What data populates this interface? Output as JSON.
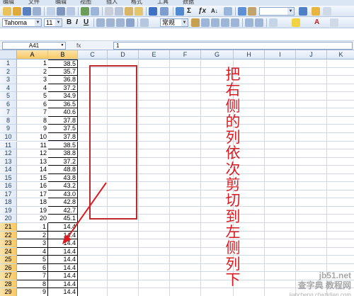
{
  "menu": {
    "items": [
      "编辑",
      "文件",
      "编辑",
      "视图",
      "插入",
      "格式",
      "工具",
      "数据"
    ]
  },
  "toolbar": {
    "font_name": "Tahoma",
    "font_size": "11",
    "number_format": "常规",
    "bold_label": "B",
    "italic_label": "I",
    "underline_label": "U",
    "sum_label": "Σ",
    "fx_label": "ƒx",
    "sort_label": "A↓",
    "font_color_label": "A"
  },
  "formula_bar": {
    "name_box": "A41",
    "fx_label": "fx",
    "value": "1"
  },
  "columns": [
    "A",
    "B",
    "C",
    "D",
    "E",
    "F",
    "G",
    "H",
    "I",
    "J",
    "K"
  ],
  "rows": [
    {
      "num": "1",
      "a": "1",
      "b": "38.5"
    },
    {
      "num": "2",
      "a": "2",
      "b": "35.7"
    },
    {
      "num": "3",
      "a": "3",
      "b": "36.8"
    },
    {
      "num": "4",
      "a": "4",
      "b": "37.2"
    },
    {
      "num": "5",
      "a": "5",
      "b": "34.9"
    },
    {
      "num": "6",
      "a": "6",
      "b": "36.5"
    },
    {
      "num": "7",
      "a": "7",
      "b": "40.6"
    },
    {
      "num": "8",
      "a": "8",
      "b": "37.8"
    },
    {
      "num": "9",
      "a": "9",
      "b": "37.5"
    },
    {
      "num": "10",
      "a": "10",
      "b": "37.8"
    },
    {
      "num": "11",
      "a": "11",
      "b": "38.5"
    },
    {
      "num": "12",
      "a": "12",
      "b": "38.8"
    },
    {
      "num": "13",
      "a": "13",
      "b": "37.2"
    },
    {
      "num": "14",
      "a": "14",
      "b": "48.8"
    },
    {
      "num": "15",
      "a": "15",
      "b": "43.8"
    },
    {
      "num": "16",
      "a": "16",
      "b": "43.2"
    },
    {
      "num": "17",
      "a": "17",
      "b": "43.0"
    },
    {
      "num": "18",
      "a": "18",
      "b": "42.8"
    },
    {
      "num": "19",
      "a": "19",
      "b": "42.7"
    },
    {
      "num": "20",
      "a": "20",
      "b": "45.1"
    },
    {
      "num": "21",
      "a": "1",
      "b": "14.4"
    },
    {
      "num": "22",
      "a": "2",
      "b": "14.4"
    },
    {
      "num": "23",
      "a": "3",
      "b": "14.4"
    },
    {
      "num": "24",
      "a": "4",
      "b": "14.4"
    },
    {
      "num": "25",
      "a": "5",
      "b": "14.4"
    },
    {
      "num": "26",
      "a": "6",
      "b": "14.4"
    },
    {
      "num": "27",
      "a": "7",
      "b": "14.4"
    },
    {
      "num": "28",
      "a": "8",
      "b": "14.4"
    },
    {
      "num": "29",
      "a": "9",
      "b": "14.4"
    }
  ],
  "annotation": {
    "text": "把右侧的列依次剪切到左侧列下",
    "color": "#d81c22"
  },
  "watermark": {
    "line1": "查字典 教程网",
    "line2": "jiaocheng.chazidian.com",
    "corner": "jb51.net"
  }
}
